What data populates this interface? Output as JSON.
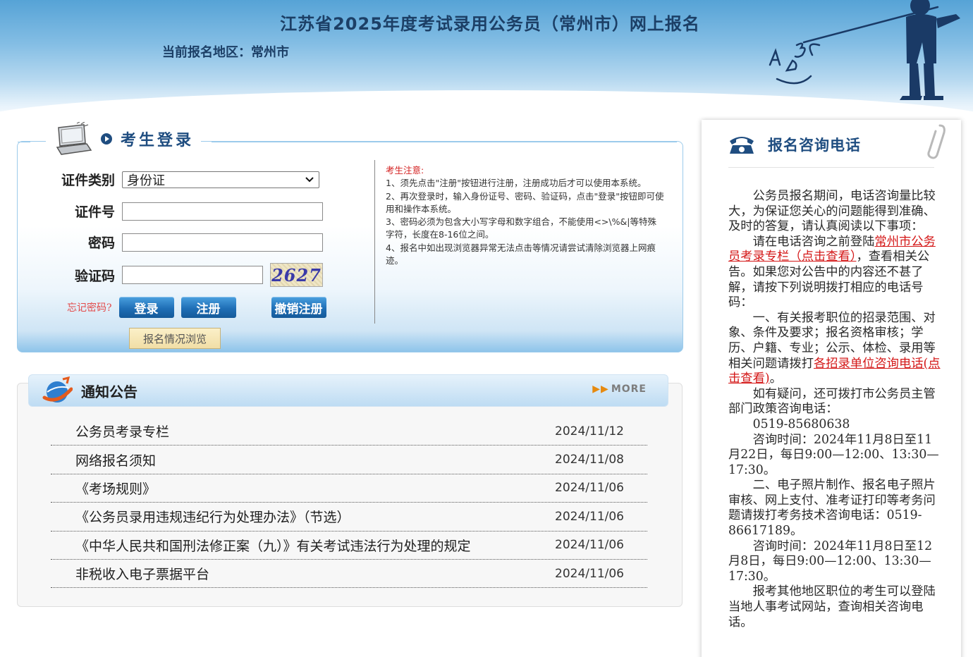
{
  "header": {
    "title": "江苏省2025年度考试录用公务员（常州市）网上报名",
    "region_label": "当前报名地区：",
    "region_value": "常州市"
  },
  "login": {
    "title": "考生登录",
    "id_type_label": "证件类别",
    "id_type_value": "身份证",
    "id_number_label": "证件号",
    "id_number_value": "",
    "password_label": "密码",
    "password_value": "",
    "captcha_label": "验证码",
    "captcha_value": "",
    "captcha_image_text": "2627",
    "forgot_password": "忘记密码?",
    "login_button": "登录",
    "register_button": "注册",
    "cancel_register_button": "撤销注册",
    "browse_button": "报名情况浏览"
  },
  "notice": {
    "title": "考生注意:",
    "items": [
      "1、须先点击\"注册\"按钮进行注册，注册成功后才可以使用本系统。",
      "2、再次登录时，输入身份证号、密码、验证码，点击\"登录\"按钮即可使用和操作本系统。",
      "3、密码必须为包含大小写字母和数字组合，不能使用<>\\%&|等特殊字符，长度在8-16位之间。",
      "4、报名中如出现浏览器异常无法点击等情况请尝试清除浏览器上网痕迹。"
    ]
  },
  "announcements": {
    "title": "通知公告",
    "more_label": "MORE",
    "items": [
      {
        "title": "公务员考录专栏",
        "date": "2024/11/12"
      },
      {
        "title": "网络报名须知",
        "date": "2024/11/08"
      },
      {
        "title": "《考场规则》",
        "date": "2024/11/06"
      },
      {
        "title": "《公务员录用违规违纪行为处理办法》（节选）",
        "date": "2024/11/06"
      },
      {
        "title": "《中华人民共和国刑法修正案（九）》有关考试违法行为处理的规定",
        "date": "2024/11/06"
      },
      {
        "title": "非税收入电子票据平台",
        "date": "2024/11/06"
      }
    ]
  },
  "consult": {
    "title": "报名咨询电话",
    "p1": "公务员报名期间，电话咨询量比较大，为保证您关心的问题能得到准确、及时的答复，请认真阅读以下事项：",
    "p2_before": "请在电话咨询之前登陆",
    "p2_link": "常州市公务员考录专栏（点击查看）",
    "p2_after": "，查看相关公告。如果您对公告中的内容还不甚了解，请按下列说明拨打相应的电话号码：",
    "p3_before": "一、有关报考职位的招录范围、对象、条件及要求；报名资格审核；学历、户籍、专业；公示、体检、录用等相关问题请拨打",
    "p3_link": "各招录单位咨询电话(点击查看)",
    "p3_after": "。",
    "p4": "如有疑问，还可拨打市公务员主管部门政策咨询电话：",
    "p4_phone": "0519-85680638",
    "p5": "咨询时间：2024年11月8日至11月22日，每日9:00—12:00、13:30—17:30。",
    "p6": "二、电子照片制作、报名电子照片审核、网上支付、准考证打印等考务问题请拨打考务技术咨询电话：0519-86617189。",
    "p7": "咨询时间：2024年11月8日至12月8日，每日9:00—12:00、13:30—17:30。",
    "p8": "报考其他地区职位的考生可以登陆当地人事考试网站，查询相关咨询电话。"
  },
  "colors": {
    "brand_blue": "#1f4d80",
    "button_blue": "#1f6fb6",
    "link_red": "#d41818",
    "notice_red": "#d31f1f"
  },
  "icons": {
    "computer": "computer-icon",
    "bullet": "play-bullet-icon",
    "globe": "globe-icon",
    "phone": "phone-icon",
    "clip": "paperclip-icon",
    "more_arrow": "double-arrow-icon",
    "select_arrow": "chevron-down-icon"
  }
}
